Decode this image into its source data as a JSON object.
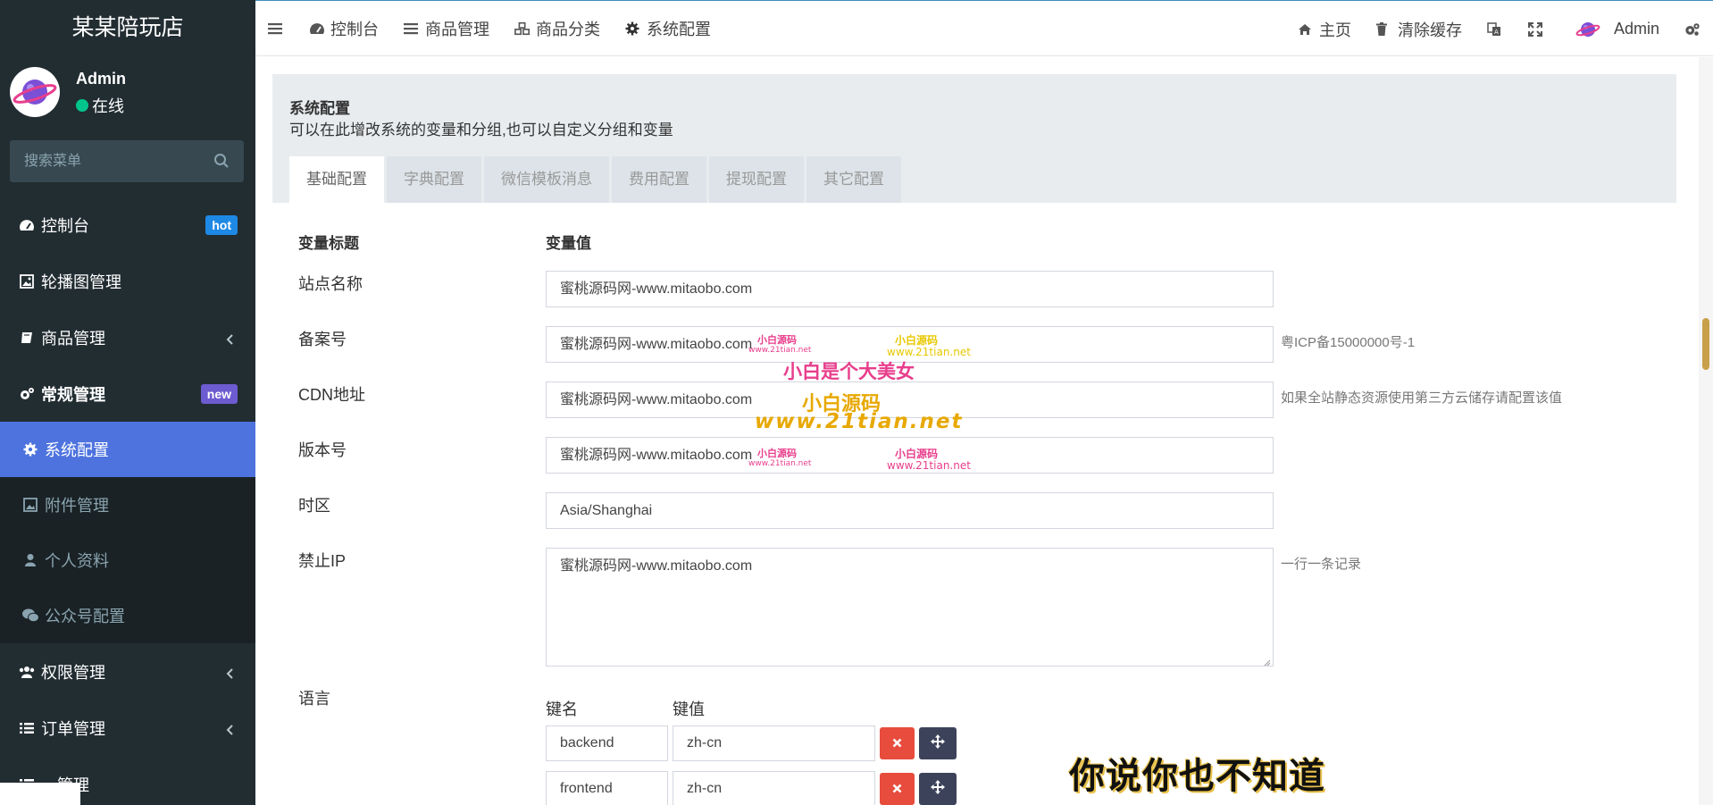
{
  "app": {
    "title": "某某陪玩店"
  },
  "user": {
    "name": "Admin",
    "status": "在线"
  },
  "search": {
    "placeholder": "搜索菜单"
  },
  "sidebar": {
    "items": [
      {
        "label": "控制台",
        "badge": "hot",
        "icon": "dashboard-icon"
      },
      {
        "label": "轮播图管理",
        "icon": "image-icon"
      },
      {
        "label": "商品管理",
        "icon": "book-icon",
        "has_children": true
      },
      {
        "label": "常规管理",
        "badge": "new",
        "icon": "cogs-icon"
      }
    ],
    "subitems": [
      {
        "label": "系统配置",
        "icon": "gear-icon",
        "active": true
      },
      {
        "label": "附件管理",
        "icon": "image-icon"
      },
      {
        "label": "个人资料",
        "icon": "user-icon"
      },
      {
        "label": "公众号配置",
        "icon": "wechat-icon"
      }
    ],
    "items2": [
      {
        "label": "权限管理",
        "icon": "group-icon",
        "has_children": true
      },
      {
        "label": "订单管理",
        "icon": "list-icon",
        "has_children": true
      },
      {
        "label": "…管理",
        "icon": "list-icon"
      }
    ]
  },
  "topbar": {
    "tabs": [
      {
        "label": "控制台",
        "icon": "dashboard-icon"
      },
      {
        "label": "商品管理",
        "icon": "list-icon"
      },
      {
        "label": "商品分类",
        "icon": "cubes-icon"
      },
      {
        "label": "系统配置",
        "icon": "gear-icon"
      }
    ],
    "right": {
      "home": "主页",
      "clear_cache": "清除缓存",
      "admin": "Admin"
    }
  },
  "panel": {
    "title": "系统配置",
    "description": "可以在此增改系统的变量和分组,也可以自定义分组和变量",
    "tabs": [
      "基础配置",
      "字典配置",
      "微信模板消息",
      "费用配置",
      "提现配置",
      "其它配置"
    ],
    "active_tab": 0
  },
  "form": {
    "col_title": "变量标题",
    "col_value": "变量值",
    "rows": [
      {
        "label": "站点名称",
        "value": "蜜桃源码网-www.mitaobo.com",
        "hint": ""
      },
      {
        "label": "备案号",
        "value": "蜜桃源码网-www.mitaobo.com",
        "hint": "粤ICP备15000000号-1"
      },
      {
        "label": "CDN地址",
        "value": "蜜桃源码网-www.mitaobo.com",
        "hint": "如果全站静态资源使用第三方云储存请配置该值"
      },
      {
        "label": "版本号",
        "value": "蜜桃源码网-www.mitaobo.com",
        "hint": ""
      },
      {
        "label": "时区",
        "value": "Asia/Shanghai",
        "hint": ""
      },
      {
        "label": "禁止IP",
        "value": "蜜桃源码网-www.mitaobo.com",
        "hint": "一行一条记录"
      }
    ],
    "language": {
      "label": "语言",
      "key_header": "键名",
      "value_header": "键值",
      "entries": [
        {
          "key": "backend",
          "value": "zh-cn"
        },
        {
          "key": "frontend",
          "value": "zh-cn"
        }
      ]
    }
  },
  "watermarks": {
    "small_a": "小白源码",
    "small_url": "www.21tian.net",
    "pink_line": "小白是个大美女",
    "orange_line": "小白源码",
    "orange_url": "www.21tian.net"
  },
  "subtitle": "你说你也不知道",
  "colors": {
    "sidebar_bg": "#222d32",
    "active": "#4e73df",
    "hot_badge": "#1e88e5",
    "new_badge": "#6d5bd0",
    "danger": "#e74c3c"
  }
}
